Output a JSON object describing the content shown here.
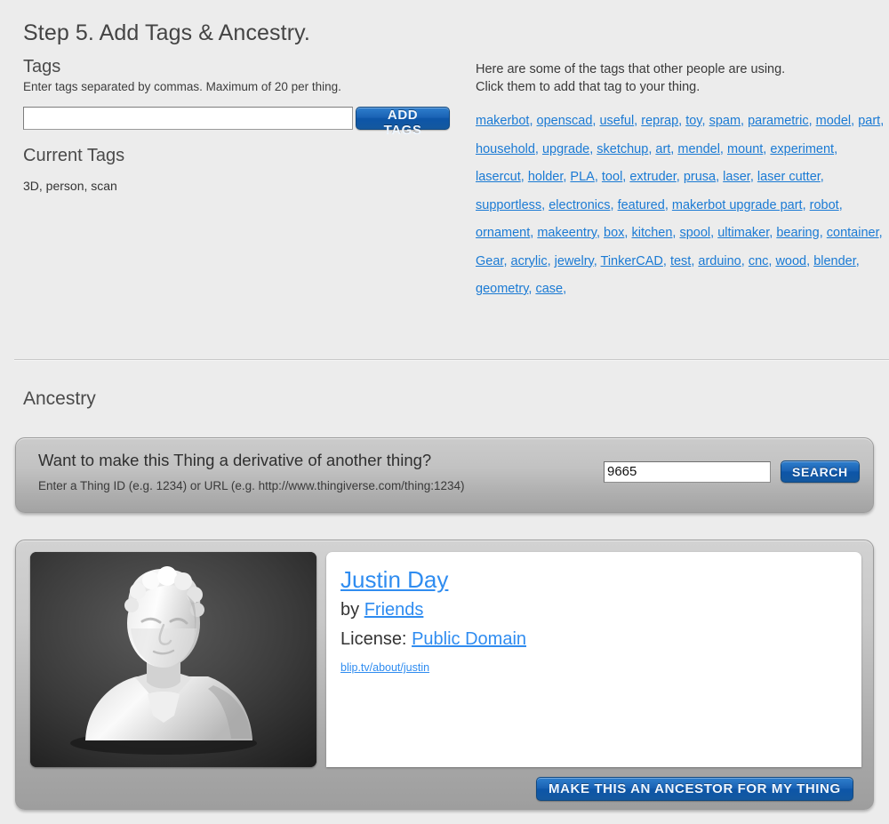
{
  "page": {
    "title": "Step 5. Add Tags & Ancestry."
  },
  "tags_section": {
    "label": "Tags",
    "instructions": "Enter tags separated by commas. Maximum of 20 per thing.",
    "input_value": "",
    "input_placeholder": "",
    "add_button_label": "ADD TAGS",
    "current_tags_label": "Current Tags",
    "current_tags_value": "3D, person, scan"
  },
  "popular_tags": {
    "intro_line1": "Here are some of the tags that other people are using.",
    "intro_line2": "Click them to add that tag to your thing.",
    "link_color": "#1a7ad4",
    "items": [
      "makerbot",
      "openscad",
      "useful",
      "reprap",
      "toy",
      "spam",
      "parametric",
      "model",
      "part",
      "household",
      "upgrade",
      "sketchup",
      "art",
      "mendel",
      "mount",
      "experiment",
      "lasercut",
      "holder",
      "PLA",
      "tool",
      "extruder",
      "prusa",
      "laser",
      "laser cutter",
      "supportless",
      "electronics",
      "featured",
      "makerbot upgrade part",
      "robot",
      "ornament",
      "makeentry",
      "box",
      "kitchen",
      "spool",
      "ultimaker",
      "bearing",
      "container",
      "Gear",
      "acrylic",
      "jewelry",
      "TinkerCAD",
      "test",
      "arduino",
      "cnc",
      "wood",
      "blender",
      "geometry",
      "case"
    ]
  },
  "ancestry": {
    "heading": "Ancestry",
    "question": "Want to make this Thing a derivative of another thing?",
    "hint": "Enter a Thing ID (e.g. 1234) or URL (e.g. http://www.thingiverse.com/thing:1234)",
    "search_value": "9665",
    "search_placeholder": "",
    "search_button_label": "SEARCH"
  },
  "result_card": {
    "thumbnail_alt": "3D printed white bust of a person on dark background",
    "thing_title": "Justin Day",
    "by_prefix": "by",
    "author": "Friends",
    "license_prefix": "License:",
    "license": "Public Domain",
    "source_url_text": "blip.tv/about/justin",
    "make_ancestor_button_label": "MAKE THIS AN ANCESTOR FOR MY THING"
  },
  "theme": {
    "background": "#ececec",
    "button_blue": "#1a62b4",
    "link_blue": "#2f8cf0"
  }
}
